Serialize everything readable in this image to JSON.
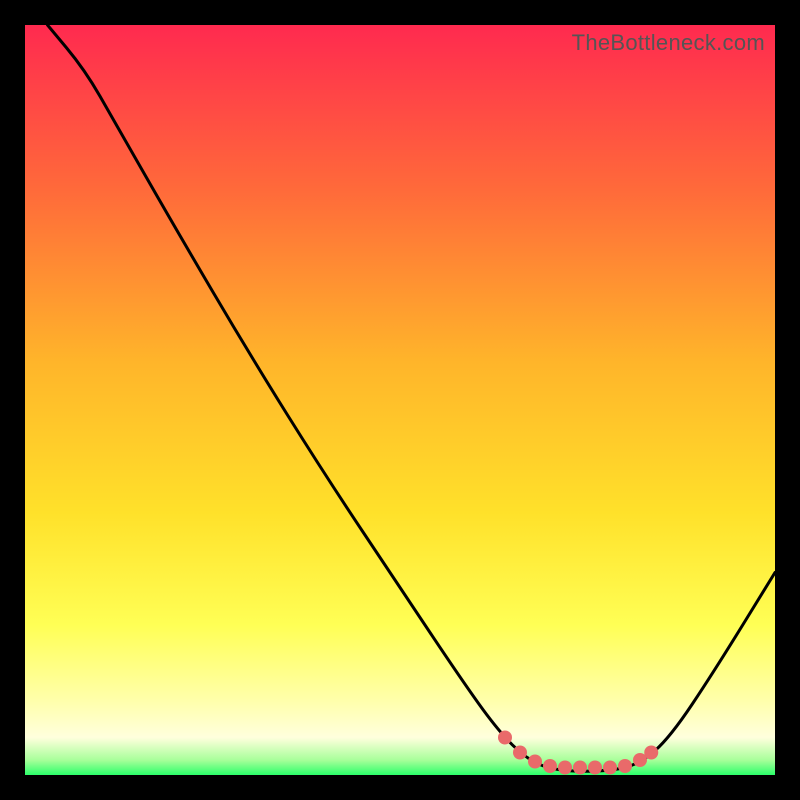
{
  "watermark": "TheBottleneck.com",
  "chart_data": {
    "type": "line",
    "title": "",
    "xlabel": "",
    "ylabel": "",
    "xrange": [
      0,
      100
    ],
    "yrange": [
      0,
      100
    ],
    "background_gradient": {
      "top": "#ff2a4f",
      "mid_upper": "#ff8a2a",
      "mid": "#ffd12a",
      "mid_lower": "#ffff66",
      "near_bottom": "#ffffbb",
      "bottom": "#2cff6a"
    },
    "series": [
      {
        "name": "bottleneck-curve",
        "color": "#000000",
        "points": [
          {
            "x": 3,
            "y": 100
          },
          {
            "x": 8,
            "y": 94
          },
          {
            "x": 12,
            "y": 87
          },
          {
            "x": 20,
            "y": 73
          },
          {
            "x": 30,
            "y": 56
          },
          {
            "x": 40,
            "y": 40
          },
          {
            "x": 50,
            "y": 25
          },
          {
            "x": 58,
            "y": 13
          },
          {
            "x": 63,
            "y": 6
          },
          {
            "x": 67,
            "y": 2
          },
          {
            "x": 71,
            "y": 0.5
          },
          {
            "x": 78,
            "y": 0.5
          },
          {
            "x": 82,
            "y": 1.5
          },
          {
            "x": 86,
            "y": 5
          },
          {
            "x": 92,
            "y": 14
          },
          {
            "x": 100,
            "y": 27
          }
        ]
      },
      {
        "name": "highlight-trough",
        "color": "#e96a6a",
        "style": "dotted-thick",
        "points": [
          {
            "x": 64,
            "y": 5
          },
          {
            "x": 66,
            "y": 3
          },
          {
            "x": 68,
            "y": 1.8
          },
          {
            "x": 70,
            "y": 1.2
          },
          {
            "x": 72,
            "y": 1.0
          },
          {
            "x": 74,
            "y": 1.0
          },
          {
            "x": 76,
            "y": 1.0
          },
          {
            "x": 78,
            "y": 1.0
          },
          {
            "x": 80,
            "y": 1.2
          },
          {
            "x": 82,
            "y": 2.0
          },
          {
            "x": 83.5,
            "y": 3.0
          }
        ]
      }
    ]
  }
}
